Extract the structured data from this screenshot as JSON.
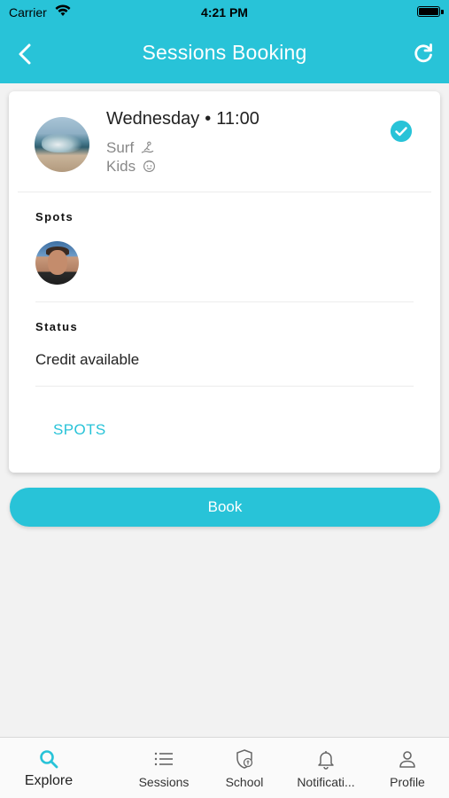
{
  "status_bar": {
    "carrier": "Carrier",
    "time": "4:21 PM"
  },
  "nav": {
    "title": "Sessions Booking",
    "back_icon": "chevron-left-icon",
    "refresh_icon": "refresh-icon"
  },
  "session": {
    "day": "Wednesday",
    "separator": "•",
    "time": "11:00",
    "activity": "Surf",
    "group": "Kids",
    "selected": true
  },
  "spots_section": {
    "label": "Spots"
  },
  "status_section": {
    "label": "Status",
    "value": "Credit available"
  },
  "spots_button": {
    "label": "SPOTS"
  },
  "book_button": {
    "label": "Book"
  },
  "tabbar": {
    "items": [
      {
        "label": "Explore",
        "icon": "search-icon",
        "active": true
      },
      {
        "label": "Sessions",
        "icon": "list-icon",
        "active": false
      },
      {
        "label": "School",
        "icon": "shield-icon",
        "active": false
      },
      {
        "label": "Notificati...",
        "icon": "bell-icon",
        "active": false
      },
      {
        "label": "Profile",
        "icon": "person-icon",
        "active": false
      }
    ]
  },
  "colors": {
    "accent": "#28c3d8",
    "background": "#f2f2f2",
    "card": "#ffffff"
  }
}
